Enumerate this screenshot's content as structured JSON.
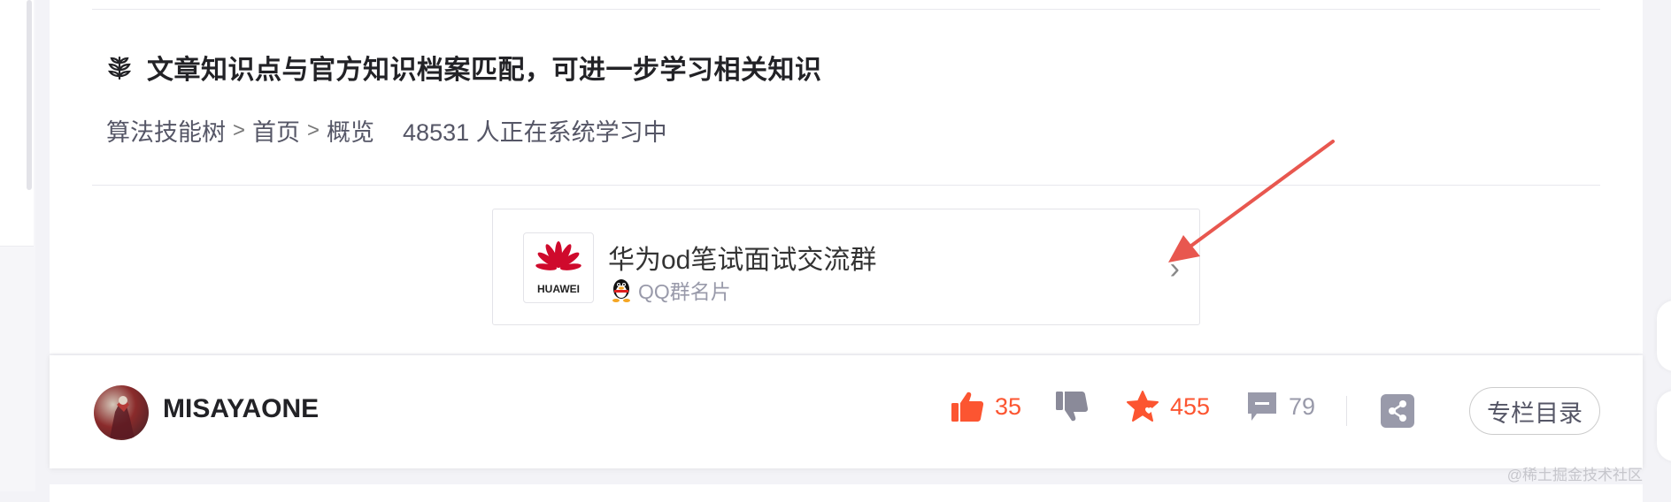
{
  "knowledge": {
    "title": "文章知识点与官方知识档案匹配，可进一步学习相关知识",
    "path": [
      "算法技能树",
      "首页",
      "概览"
    ],
    "path_separator": ">",
    "learners": "48531 人正在系统学习中"
  },
  "qq_group": {
    "logo_brand": "HUAWEI",
    "title": "华为od笔试面试交流群",
    "subtitle": "QQ群名片",
    "chevron": "›"
  },
  "author": {
    "name": "MISAYAONE"
  },
  "actions": {
    "like_count": "35",
    "favorite_count": "455",
    "comment_count": "79",
    "catalog_label": "专栏目录"
  },
  "watermark": "@稀土掘金技术社区",
  "colors": {
    "accent": "#fc5531",
    "muted_icon": "#999aaa",
    "annotation_arrow": "#e8574f",
    "huawei_red": "#cf0a2c"
  },
  "icons": {
    "knowledge": "knowledge-tree-icon",
    "like": "thumbs-up-icon",
    "dislike": "thumbs-down-icon",
    "favorite": "star-icon",
    "comment": "comment-icon",
    "share": "share-icon",
    "qq": "qq-penguin-icon",
    "chevron": "chevron-right-icon"
  }
}
